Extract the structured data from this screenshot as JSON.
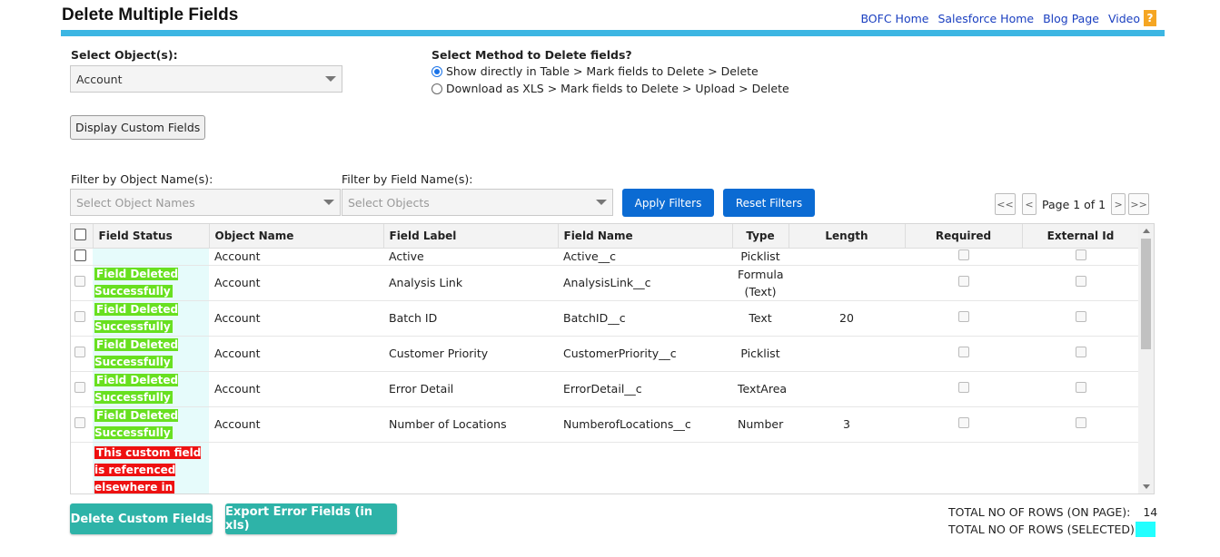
{
  "title": "Delete Multiple Fields",
  "top_links": [
    {
      "label": "BOFC Home"
    },
    {
      "label": "Salesforce Home"
    },
    {
      "label": "Blog Page"
    },
    {
      "label": "Video"
    }
  ],
  "help_icon_glyph": "?",
  "select_object": {
    "label": "Select Object(s):",
    "value": "Account"
  },
  "method": {
    "label": "Select Method to Delete fields?",
    "options": [
      {
        "label": "Show directly in Table > Mark fields to Delete > Delete",
        "selected": true
      },
      {
        "label": "Download as XLS > Mark fields to Delete > Upload > Delete",
        "selected": false
      }
    ]
  },
  "display_button": "Display Custom Fields",
  "filters": {
    "object_label": "Filter by Object Name(s):",
    "object_placeholder": "Select Object Names",
    "field_label": "Filter by Field Name(s):",
    "field_placeholder": "Select Objects",
    "apply": "Apply Filters",
    "reset": "Reset Filters"
  },
  "pager": {
    "first": "<<",
    "prev": "<",
    "text": "Page 1 of 1",
    "next": ">",
    "last": ">>"
  },
  "table": {
    "headers": [
      "Field Status",
      "Object Name",
      "Field Label",
      "Field Name",
      "Type",
      "Length",
      "Required",
      "External Id"
    ],
    "rows": [
      {
        "status": "",
        "object": "Account",
        "label": "Active",
        "name": "Active__c",
        "type": "Picklist",
        "length": ""
      },
      {
        "status": "Field Deleted Successfully",
        "object": "Account",
        "label": "Analysis Link",
        "name": "AnalysisLink__c",
        "type": "Formula (Text)",
        "length": ""
      },
      {
        "status": "Field Deleted Successfully",
        "object": "Account",
        "label": "Batch ID",
        "name": "BatchID__c",
        "type": "Text",
        "length": "20"
      },
      {
        "status": "Field Deleted Successfully",
        "object": "Account",
        "label": "Customer Priority",
        "name": "CustomerPriority__c",
        "type": "Picklist",
        "length": ""
      },
      {
        "status": "Field Deleted Successfully",
        "object": "Account",
        "label": "Error Detail",
        "name": "ErrorDetail__c",
        "type": "TextArea",
        "length": ""
      },
      {
        "status": "Field Deleted Successfully",
        "object": "Account",
        "label": "Number of Locations",
        "name": "NumberofLocations__c",
        "type": "Number",
        "length": "3"
      },
      {
        "status": "This custom field is referenced elsewhere in",
        "object": "",
        "label": "",
        "name": "",
        "type": "",
        "length": ""
      }
    ]
  },
  "bottom_buttons": {
    "delete": "Delete Custom Fields",
    "export": "Export Error Fields (in xls)"
  },
  "totals": {
    "on_page_label": "TOTAL NO OF ROWS (ON PAGE):",
    "on_page_value": "14",
    "selected_label": "TOTAL NO OF ROWS (SELECTED):",
    "selected_value": ""
  },
  "colors": {
    "accent_bar": "#3cb6e3",
    "primary_button": "#0b6bd3",
    "teal_button": "#2eb3a8",
    "success_badge": "#68e020",
    "error_badge": "#ee1111",
    "selected_swatch": "#22ffff"
  }
}
